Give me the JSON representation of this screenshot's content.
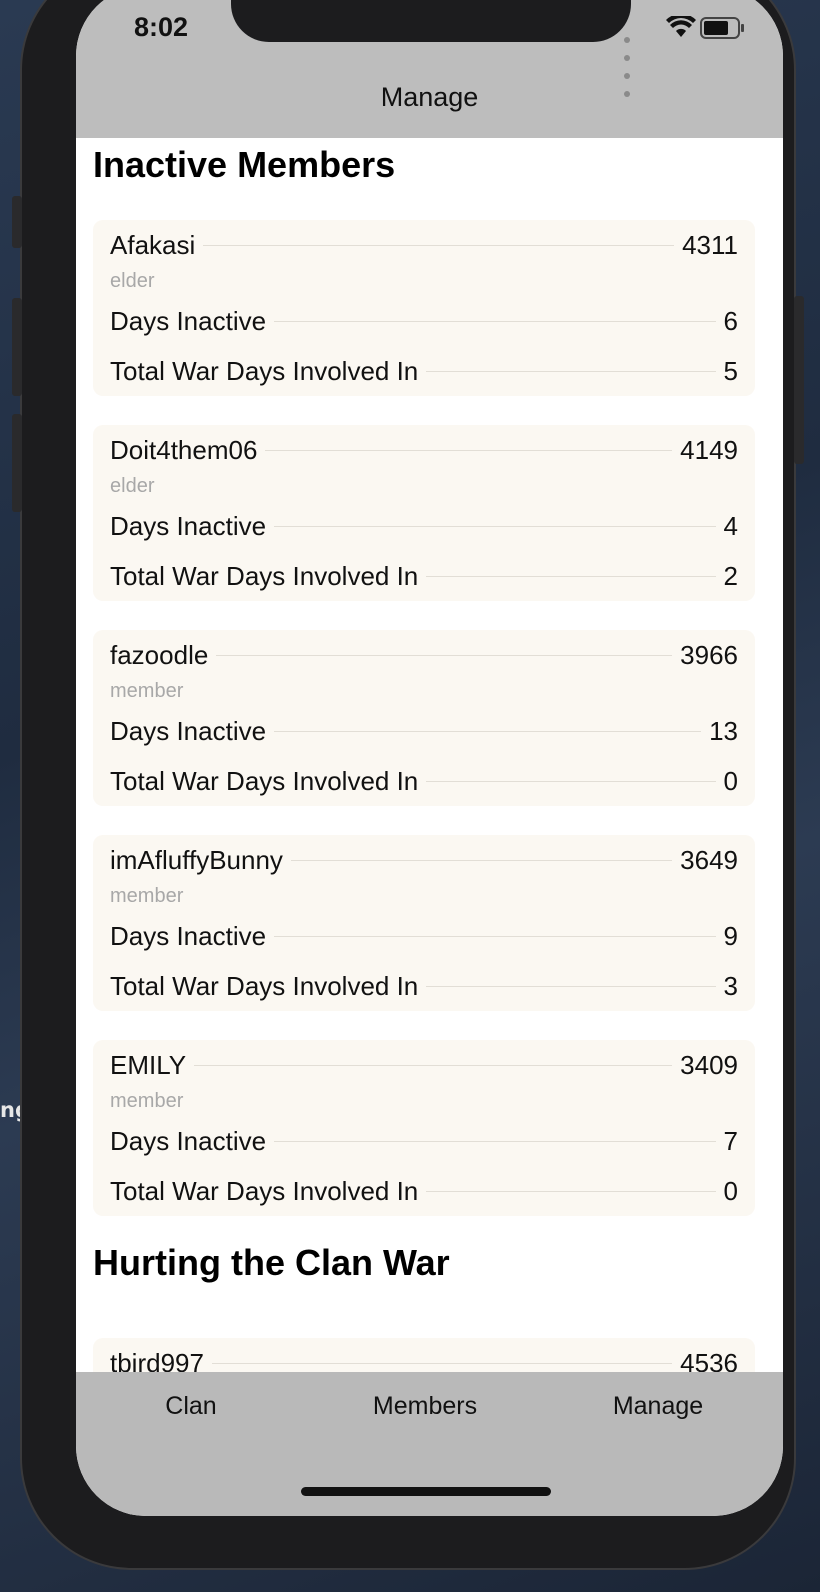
{
  "desktop": {
    "fragment_text": "ng"
  },
  "status_bar": {
    "time": "8:02"
  },
  "nav": {
    "title": "Manage"
  },
  "sections": [
    {
      "title": "Inactive Members"
    },
    {
      "title": "Hurting the Clan War"
    }
  ],
  "labels": {
    "days_inactive": "Days Inactive",
    "total_war_days": "Total War Days Involved In"
  },
  "inactive_members": [
    {
      "name": "Afakasi",
      "score": "4311",
      "role": "elder",
      "days_inactive": "6",
      "war_days": "5"
    },
    {
      "name": "Doit4them06",
      "score": "4149",
      "role": "elder",
      "days_inactive": "4",
      "war_days": "2"
    },
    {
      "name": "fazoodle",
      "score": "3966",
      "role": "member",
      "days_inactive": "13",
      "war_days": "0"
    },
    {
      "name": "imAfluffyBunny",
      "score": "3649",
      "role": "member",
      "days_inactive": "9",
      "war_days": "3"
    },
    {
      "name": "EMILY",
      "score": "3409",
      "role": "member",
      "days_inactive": "7",
      "war_days": "0"
    }
  ],
  "hurting_members": [
    {
      "name": "tbird997",
      "score": "4536"
    }
  ],
  "tabbar": {
    "tabs": [
      {
        "label": "Clan"
      },
      {
        "label": "Members"
      },
      {
        "label": "Manage"
      }
    ]
  }
}
